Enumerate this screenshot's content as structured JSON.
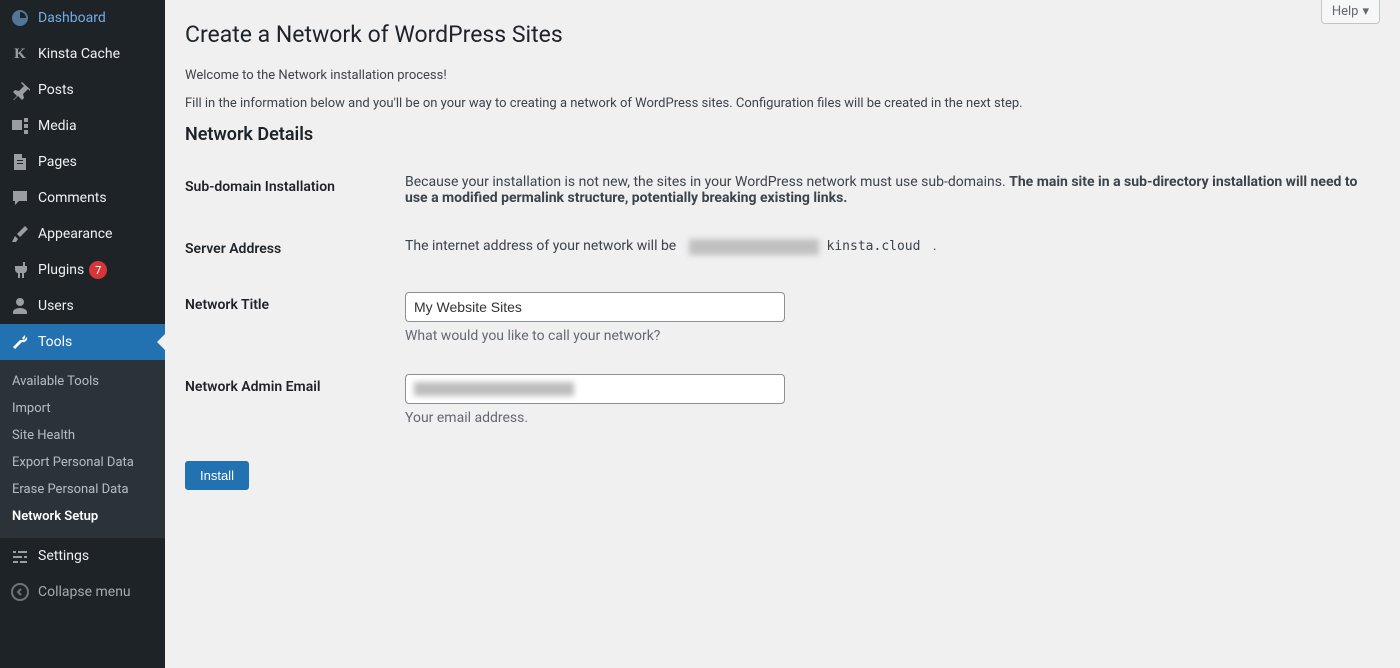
{
  "sidebar": {
    "items": [
      {
        "label": "Dashboard"
      },
      {
        "label": "Kinsta Cache"
      },
      {
        "label": "Posts"
      },
      {
        "label": "Media"
      },
      {
        "label": "Pages"
      },
      {
        "label": "Comments"
      },
      {
        "label": "Appearance"
      },
      {
        "label": "Plugins",
        "badge": "7"
      },
      {
        "label": "Users"
      },
      {
        "label": "Tools"
      },
      {
        "label": "Settings"
      }
    ],
    "submenu": [
      {
        "label": "Available Tools"
      },
      {
        "label": "Import"
      },
      {
        "label": "Site Health"
      },
      {
        "label": "Export Personal Data"
      },
      {
        "label": "Erase Personal Data"
      },
      {
        "label": "Network Setup"
      }
    ],
    "collapse": "Collapse menu"
  },
  "topbar": {
    "help": "Help"
  },
  "page": {
    "title": "Create a Network of WordPress Sites",
    "intro1": "Welcome to the Network installation process!",
    "intro2": "Fill in the information below and you'll be on your way to creating a network of WordPress sites. Configuration files will be created in the next step.",
    "section": "Network Details",
    "rows": {
      "subdomain": {
        "label": "Sub-domain Installation",
        "text": "Because your installation is not new, the sites in your WordPress network must use sub-domains. ",
        "bold": "The main site in a sub-directory installation will need to use a modified permalink structure, potentially breaking existing links."
      },
      "server": {
        "label": "Server Address",
        "text": "The internet address of your network will be ",
        "suffix": "kinsta.cloud",
        "period": " ."
      },
      "title": {
        "label": "Network Title",
        "value": "My Website Sites",
        "desc": "What would you like to call your network?"
      },
      "email": {
        "label": "Network Admin Email",
        "desc": "Your email address."
      }
    },
    "submit": "Install"
  }
}
